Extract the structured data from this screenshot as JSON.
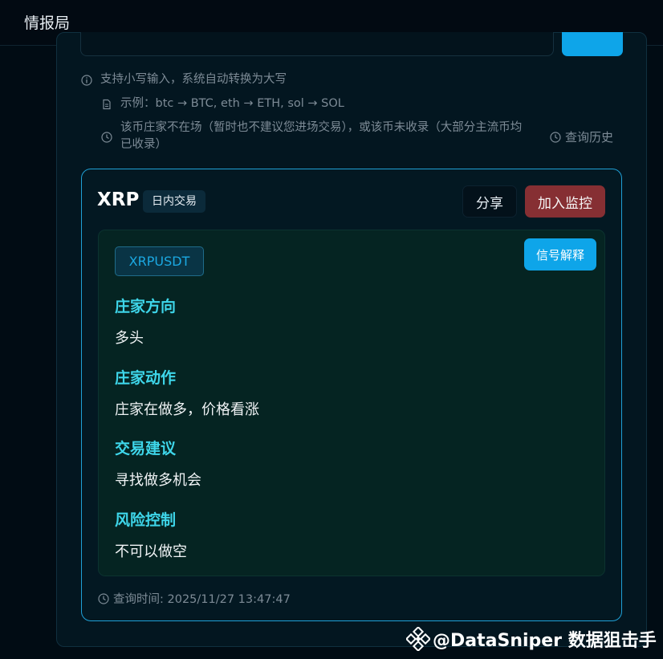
{
  "header": {
    "title": "情报局"
  },
  "hints": {
    "lowercase": "支持小写输入，系统自动转换为大写",
    "example": "示例：btc → BTC, eth → ETH, sol → SOL",
    "absent_line1": "该币庄家不在场（暂时也不建议您进场交易），或该币未收录（大部分主流币均",
    "absent_line2": "已收录）"
  },
  "history_link": {
    "label": "查询历史"
  },
  "result": {
    "symbol": "XRP",
    "tag": "日内交易",
    "share_label": "分享",
    "monitor_label": "加入监控",
    "pair": "XRPUSDT",
    "explain_label": "信号解释",
    "sections": [
      {
        "title": "庄家方向",
        "value": "多头"
      },
      {
        "title": "庄家动作",
        "value": "庄家在做多，价格看涨"
      },
      {
        "title": "交易建议",
        "value": "寻找做多机会"
      },
      {
        "title": "风险控制",
        "value": "不可以做空"
      }
    ],
    "query_time": "查询时间: 2025/11/27 13:47:47"
  },
  "watermark": {
    "text": "@DataSniper 数据狙击手"
  },
  "colors": {
    "accent": "#0ea5e9",
    "danger": "#862f33",
    "section_title": "#3ed6ea",
    "card_border": "#1fa0d6"
  }
}
